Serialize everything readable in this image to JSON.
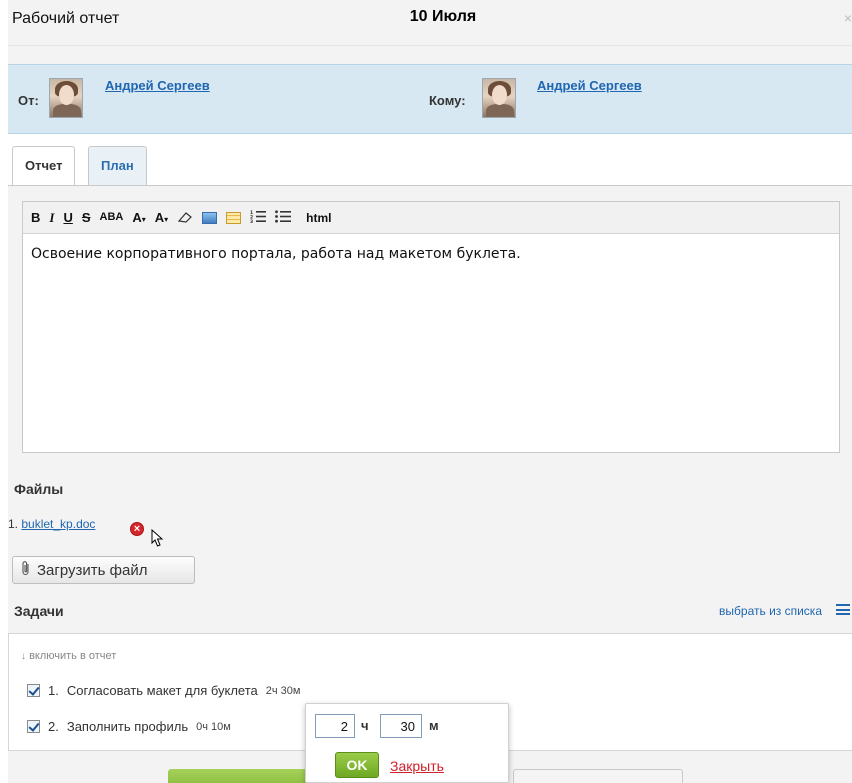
{
  "dialog": {
    "title": "Рабочий отчет",
    "date": "10 Июля",
    "close_glyph": "×"
  },
  "from_to": {
    "from_label": "От:",
    "from_name": "Андрей Сергеев",
    "to_label": "Кому:",
    "to_name": "Андрей Сергеев"
  },
  "tabs": [
    {
      "label": "Отчет",
      "active": true
    },
    {
      "label": "План",
      "active": false
    }
  ],
  "toolbar": {
    "bold": "B",
    "italic": "I",
    "underline": "U",
    "strike": "S",
    "highlight": "ABA",
    "font_size": "A",
    "font_color": "A",
    "html": "html"
  },
  "editor": {
    "content": "Освоение корпоративного портала, работа над макетом буклета."
  },
  "files": {
    "title": "Файлы",
    "items": [
      {
        "index": "1.",
        "name": "buklet_kp.doc"
      }
    ],
    "upload_label": "Загрузить файл"
  },
  "tasks": {
    "title": "Задачи",
    "pick_link": "выбрать из списка",
    "include_label": "включить в отчет",
    "items": [
      {
        "index": "1.",
        "name": "Согласовать макет для буклета",
        "time": "2ч 30м",
        "checked": true
      },
      {
        "index": "2.",
        "name": "Заполнить профиль",
        "time": "0ч 10м",
        "checked": true
      }
    ]
  },
  "time_popup": {
    "hours_value": "2",
    "hours_unit": "ч",
    "minutes_value": "30",
    "minutes_unit": "м",
    "ok_label": "OK",
    "close_label": "Закрыть"
  },
  "colors": {
    "accent_blue": "#2066b0",
    "header_blue": "#d7e8f3",
    "ok_green": "#79ae28",
    "delete_red": "#d7262b"
  }
}
